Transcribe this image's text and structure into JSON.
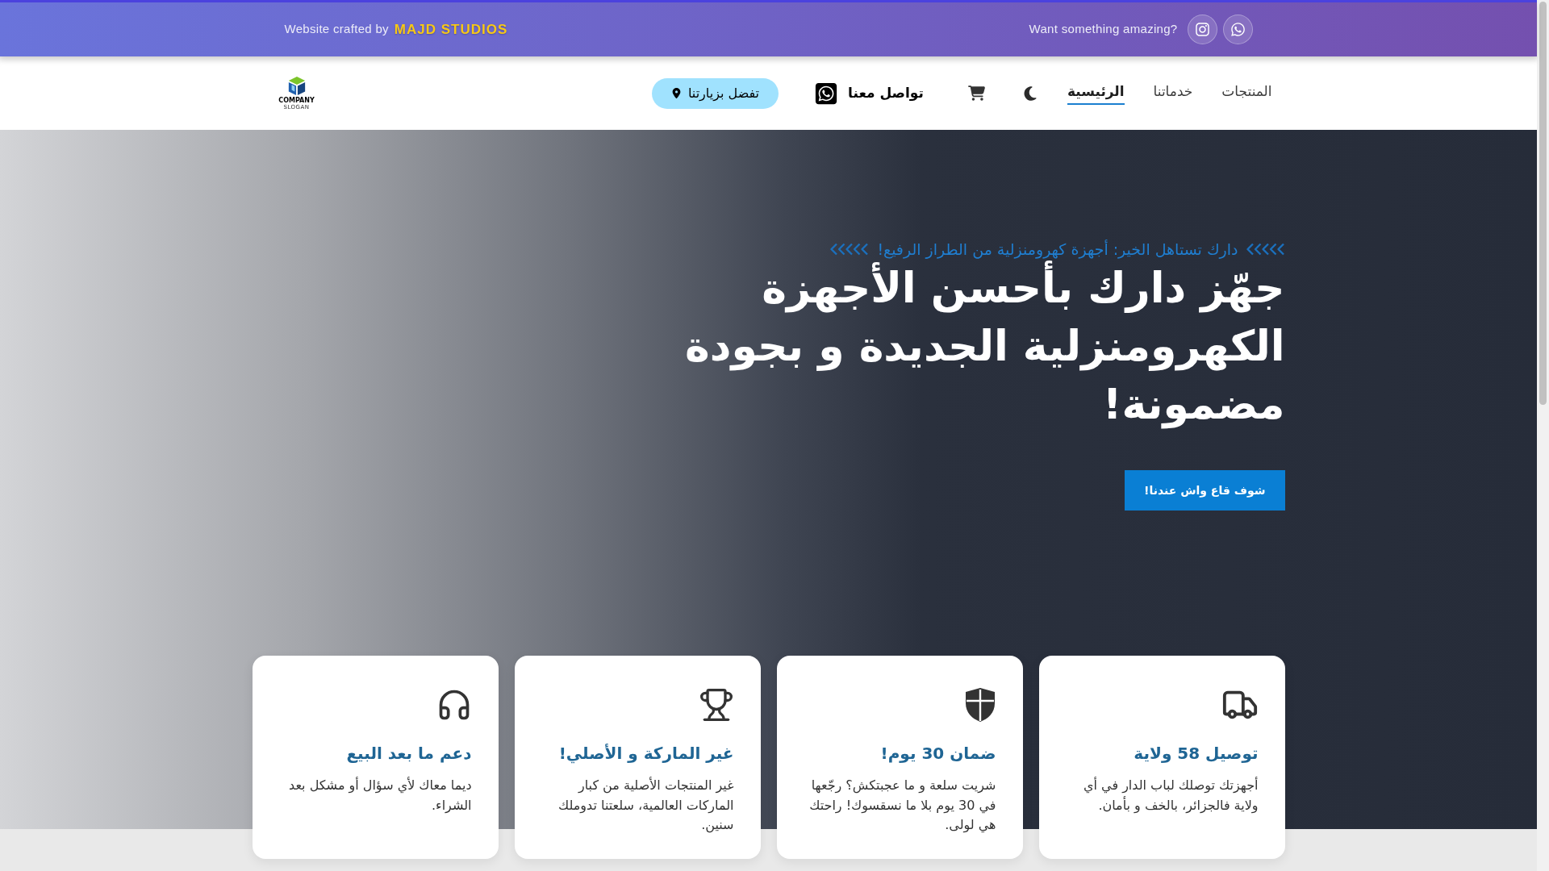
{
  "top_bar": {
    "credit": "Website crafted by",
    "studio": "MAJD STUDIOS",
    "prompt": "Want something amazing?"
  },
  "header": {
    "logo": {
      "name": "COMPANY",
      "slogan": "SLOGAN"
    },
    "nav_items": [
      {
        "label": "المنتجات",
        "selected": false
      },
      {
        "label": "خدماتنا",
        "selected": false
      },
      {
        "label": "الرئيسية",
        "selected": true
      }
    ],
    "contact_link": "تواصل معنا",
    "visit_button": "تفضل بزيارتنا"
  },
  "hero": {
    "tagline": "دارك تستاهل الخير: أجهزة كهرومنزلية من الطراز الرفيع!",
    "heading": "جهّز دارك بأحسن الأجهزة الكهرومنزلية الجديدة و بجودة مضمونة!",
    "cta_button": "شوف قاع واش عندنا!"
  },
  "features": [
    {
      "title": "توصيل 58 ولاية",
      "text": "أجهزتك توصلك لباب الدار في أي ولاية فالجزائر، بالخف و بأمان."
    },
    {
      "title": "ضمان 30 يوم!",
      "text": "شريت سلعة و ما عجبتكش؟ رجّعها في 30 يوم بلا ما نسقسوك! راحتك هي لولى."
    },
    {
      "title": "غير الماركة و الأصلي!",
      "text": "غير المنتجات الأصلية من كبار الماركات العالمية، سلعتنا تدوملك سنين."
    },
    {
      "title": "دعم ما بعد البيع",
      "text": "ديما معاك لأي سؤال أو مشكل بعد الشراء."
    }
  ]
}
